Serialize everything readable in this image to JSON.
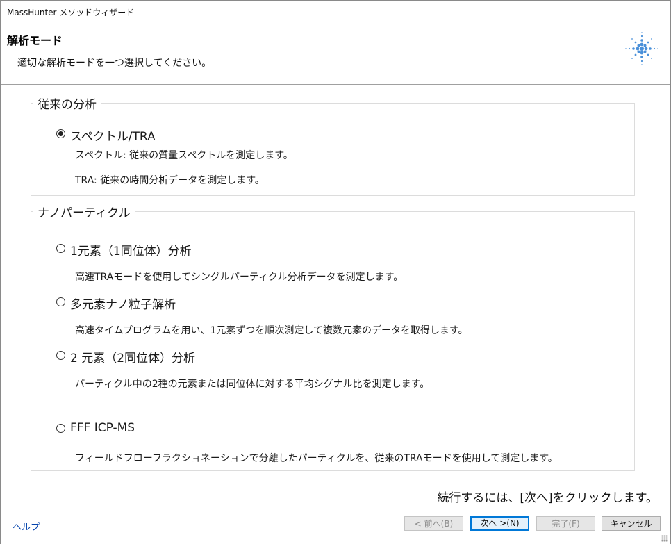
{
  "window": {
    "title": "MassHunter メソッドウィザード"
  },
  "header": {
    "title": "解析モード",
    "subtitle": "適切な解析モードを一つ選択してください。"
  },
  "groups": {
    "conventional": {
      "label": "従来の分析",
      "option": {
        "label": "スペクトル/TRA",
        "checked": true,
        "desc1": "スペクトル: 従来の質量スペクトルを測定します。",
        "desc2": "TRA: 従来の時間分析データを測定します。"
      }
    },
    "nano": {
      "label": "ナノパーティクル",
      "options": [
        {
          "label": "1元素（1同位体）分析",
          "desc": "高速TRAモードを使用してシングルパーティクル分析データを測定します。",
          "checked": false
        },
        {
          "label": "多元素ナノ粒子解析",
          "desc": "高速タイムプログラムを用い、1元素ずつを順次測定して複数元素のデータを取得します。",
          "checked": false
        },
        {
          "label": "2 元素（2同位体）分析",
          "desc": "パーティクル中の2種の元素または同位体に対する平均シグナル比を測定します。",
          "checked": false
        },
        {
          "label": "FFF ICP-MS",
          "desc": "フィールドフローフラクショネーションで分離したパーティクルを、従来のTRAモードを使用して測定します。",
          "checked": false
        }
      ]
    }
  },
  "continue_text": "続行するには、[次へ]をクリックします。",
  "footer": {
    "help": "ヘルプ",
    "back": "< 前へ(B)",
    "next": "次へ >(N)",
    "finish": "完了(F)",
    "cancel": "キャンセル"
  },
  "colors": {
    "accent": "#0078d7",
    "logo": "#4a90d9"
  }
}
